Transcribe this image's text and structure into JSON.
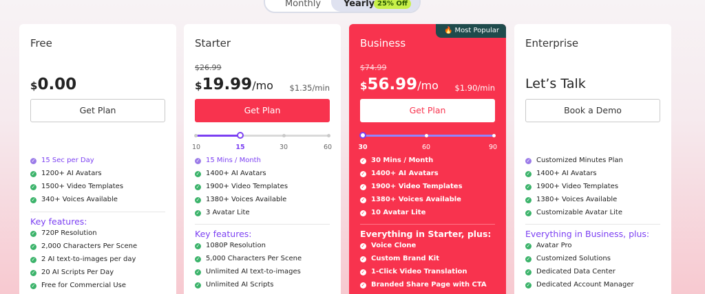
{
  "toggle": {
    "monthly": "Monthly",
    "yearly": "Yearly",
    "discount": "25% Off"
  },
  "plans": {
    "free": {
      "name": "Free",
      "currency": "$",
      "price": "0.00",
      "button": "Get Plan",
      "features": [
        "15 Sec per Day",
        "1200+ AI Avatars",
        "1500+ Video Templates",
        "340+ Voices Available"
      ],
      "section_title": "Key features:",
      "key_features": [
        "720P Resolution",
        "2,000 Characters Per Scene",
        "2 AI text-to-images per day",
        "20 AI Scripts Per Day",
        "Free for Commercial Use"
      ]
    },
    "starter": {
      "name": "Starter",
      "old_price": "$26.99",
      "currency": "$",
      "price": "19.99",
      "per": "/mo",
      "per_minute": "$1.35/min",
      "button": "Get Plan",
      "slider": {
        "ticks": [
          "10",
          "15",
          "30",
          "60"
        ],
        "selected": "15"
      },
      "features": [
        "15 Mins / Month",
        "1400+ AI Avatars",
        "1900+ Video Templates",
        "1380+ Voices Available",
        "3 Avatar Lite"
      ],
      "section_title": "Key features:",
      "key_features": [
        "1080P Resolution",
        "5,000 Characters Per Scene",
        "Unlimited AI text-to-images",
        "Unlimited AI Scripts"
      ]
    },
    "business": {
      "name": "Business",
      "badge": "Most Popular",
      "old_price": "$74.99",
      "currency": "$",
      "price": "56.99",
      "per": "/mo",
      "per_minute": "$1.90/min",
      "button": "Get Plan",
      "slider": {
        "ticks": [
          "30",
          "60",
          "90"
        ],
        "selected": "30"
      },
      "features": [
        "30 Mins / Month",
        "1400+ AI Avatars",
        "1900+ Video Templates",
        "1380+ Voices Available",
        "10 Avatar Lite"
      ],
      "section_title": "Everything in Starter, plus:",
      "key_features": [
        "Voice Clone",
        "Custom Brand Kit",
        "1-Click Video Translation",
        "Branded Share Page with CTA"
      ]
    },
    "enterprise": {
      "name": "Enterprise",
      "price_text": "Let’s Talk",
      "button": "Book a Demo",
      "features": [
        "Customized Minutes Plan",
        "1400+ AI Avatars",
        "1900+ Video Templates",
        "1380+ Voices Available",
        "Customizable Avatar Lite"
      ],
      "section_title": "Everything in Business, plus:",
      "key_features": [
        "Avatar Pro",
        "Customized Solutions",
        "Dedicated Data Center",
        "Dedicated Account Manager"
      ]
    }
  },
  "colors": {
    "brand_red": "#f8334e",
    "accent_purple": "#7b3ff2",
    "check_green": "#3bb36a",
    "badge_dark": "#1f4b4c",
    "discount_lime": "#c8f04a"
  },
  "icons": {
    "check": "check-circle-icon",
    "flame": "flame-icon"
  }
}
